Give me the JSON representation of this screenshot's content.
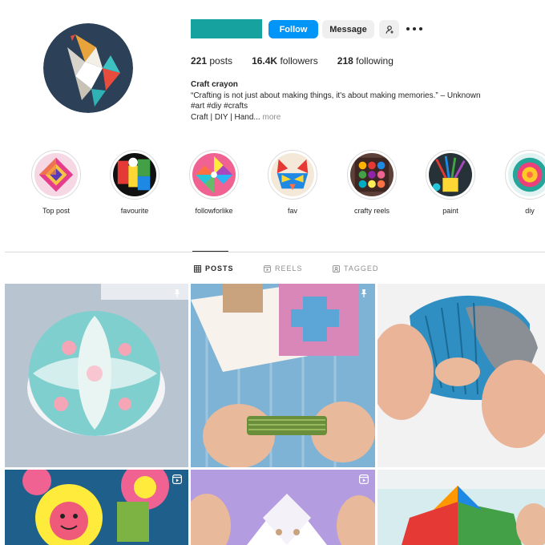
{
  "profile": {
    "follow_label": "Follow",
    "message_label": "Message",
    "posts_count": "221",
    "posts_label": "posts",
    "followers_count": "16.4K",
    "followers_label": "followers",
    "following_count": "218",
    "following_label": "following",
    "display_name": "Craft crayon",
    "bio_quote": "“Crafting is not just about making things, it's about making memories.” – Unknown",
    "bio_tags": "#art #diy #crafts",
    "bio_line3": "Craft | DIY | Hand...",
    "more_label": "more",
    "brand_color": "#16a3a0",
    "follow_color": "#0095f6"
  },
  "highlights": [
    {
      "label": "Top post",
      "icon": "origami-star-cover"
    },
    {
      "label": "favourite",
      "icon": "paper-art-cover"
    },
    {
      "label": "followforlike",
      "icon": "pinwheel-cover"
    },
    {
      "label": "fav",
      "icon": "paper-cat-cover"
    },
    {
      "label": "crafty reels",
      "icon": "craft-box-cover"
    },
    {
      "label": "paint",
      "icon": "paint-brushes-cover"
    },
    {
      "label": "diy",
      "icon": "paper-flower-cover"
    }
  ],
  "tabs": [
    {
      "label": "POSTS",
      "icon": "grid-icon",
      "active": true
    },
    {
      "label": "REELS",
      "icon": "reels-icon",
      "active": false
    },
    {
      "label": "TAGGED",
      "icon": "tagged-icon",
      "active": false
    }
  ],
  "posts": [
    {
      "subject": "floral-paper-ball",
      "badge": "pin-icon"
    },
    {
      "subject": "paper-card-folding",
      "badge": "pin-icon"
    },
    {
      "subject": "paper-fan-toy",
      "badge": ""
    },
    {
      "subject": "paper-flower-crafts",
      "badge": "reels-icon"
    },
    {
      "subject": "paper-fold-purple",
      "badge": "reels-icon"
    },
    {
      "subject": "origami-star-toy",
      "badge": ""
    }
  ]
}
